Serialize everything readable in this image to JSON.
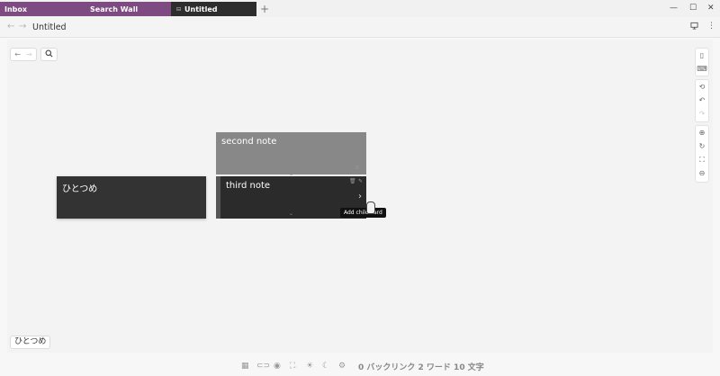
{
  "tabs": {
    "inbox_label": "Inbox",
    "wall_label": "Search Wall",
    "active_label": "Untitled",
    "active_icon": "canvas-icon",
    "new_tab": "+"
  },
  "window": {
    "minimize": "—",
    "maximize": "☐",
    "close": "✕"
  },
  "address": {
    "back": "←",
    "forward": "→",
    "title": "Untitled",
    "present_icon": "monitor-icon",
    "menu_icon": "more-vertical-icon"
  },
  "toolbar": {
    "back": "←",
    "forward": "→",
    "search_icon": "search-icon"
  },
  "cards": {
    "first": {
      "text": "ひとつめ"
    },
    "second": {
      "text": "second note"
    },
    "third": {
      "text": "third note",
      "actions": [
        "trash-icon",
        "edit-icon"
      ],
      "expand": "›"
    }
  },
  "tooltip": "Add child card",
  "bottom_label": "ひとつめ",
  "status": {
    "summary": "0 バックリンク  2 ワード  10 文字",
    "icons": [
      "calendar-icon",
      "toggle-icon",
      "eye-icon",
      "fullscreen-icon",
      "sun-icon",
      "moon-icon",
      "gear-icon"
    ]
  },
  "colors": {
    "tab_inbox": "#7d4b81",
    "tab_active": "#2d2d2d",
    "card_dark": "#333333",
    "card_light": "#888888",
    "canvas_bg": "#f3f3f3"
  }
}
